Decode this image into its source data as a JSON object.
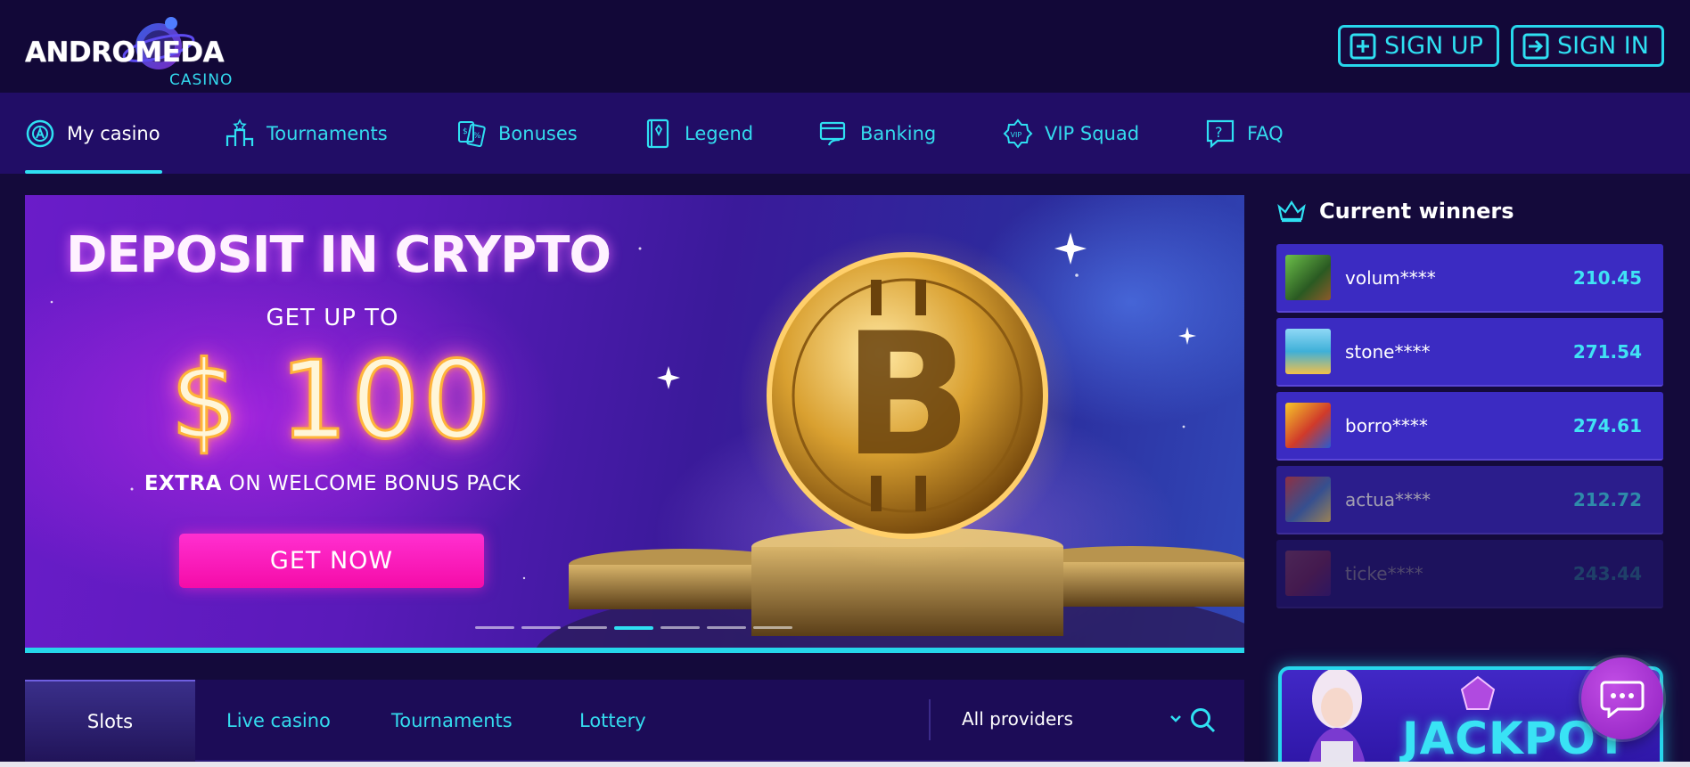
{
  "brand": {
    "name": "ANDROMEDA",
    "sub": "CASINO"
  },
  "auth": {
    "signup": "SIGN UP",
    "signin": "SIGN IN"
  },
  "nav": [
    {
      "label": "My casino",
      "icon": "casino-chip-icon",
      "active": true
    },
    {
      "label": "Tournaments",
      "icon": "podium-icon",
      "active": false
    },
    {
      "label": "Bonuses",
      "icon": "bonus-cards-icon",
      "active": false
    },
    {
      "label": "Legend",
      "icon": "legend-book-icon",
      "active": false
    },
    {
      "label": "Banking",
      "icon": "banking-card-icon",
      "active": false
    },
    {
      "label": "VIP Squad",
      "icon": "vip-badge-icon",
      "active": false
    },
    {
      "label": "FAQ",
      "icon": "question-icon",
      "active": false
    }
  ],
  "hero": {
    "title": "DEPOSIT IN CRYPTO",
    "sub": "GET UP TO",
    "amount": "$ 100",
    "extra_bold": "EXTRA",
    "extra_rest": " ON WELCOME BONUS PACK",
    "cta": "GET NOW",
    "slide_count": 7,
    "active_slide": 4
  },
  "winners": {
    "title": "Current winners",
    "rows": [
      {
        "name": "volum****",
        "amount": "210.45",
        "color": "#4a8a3a"
      },
      {
        "name": "stone****",
        "amount": "271.54",
        "color": "#3fb0d8"
      },
      {
        "name": "borro****",
        "amount": "274.61",
        "color": "#e0a020"
      },
      {
        "name": "actua****",
        "amount": "212.72",
        "color": "#4d7ec8"
      },
      {
        "name": "ticke****",
        "amount": "243.44",
        "color": "#d24a8a"
      }
    ]
  },
  "filters": {
    "tabs": [
      "Slots",
      "Live casino",
      "Tournaments",
      "Lottery"
    ],
    "provider": "All providers"
  },
  "jackpot": {
    "label": "JACKPOT"
  },
  "colors": {
    "accent": "#2fe0f2",
    "pink": "#f50ca8",
    "nav_bg": "#210d66",
    "page_bg": "#140a3b"
  }
}
